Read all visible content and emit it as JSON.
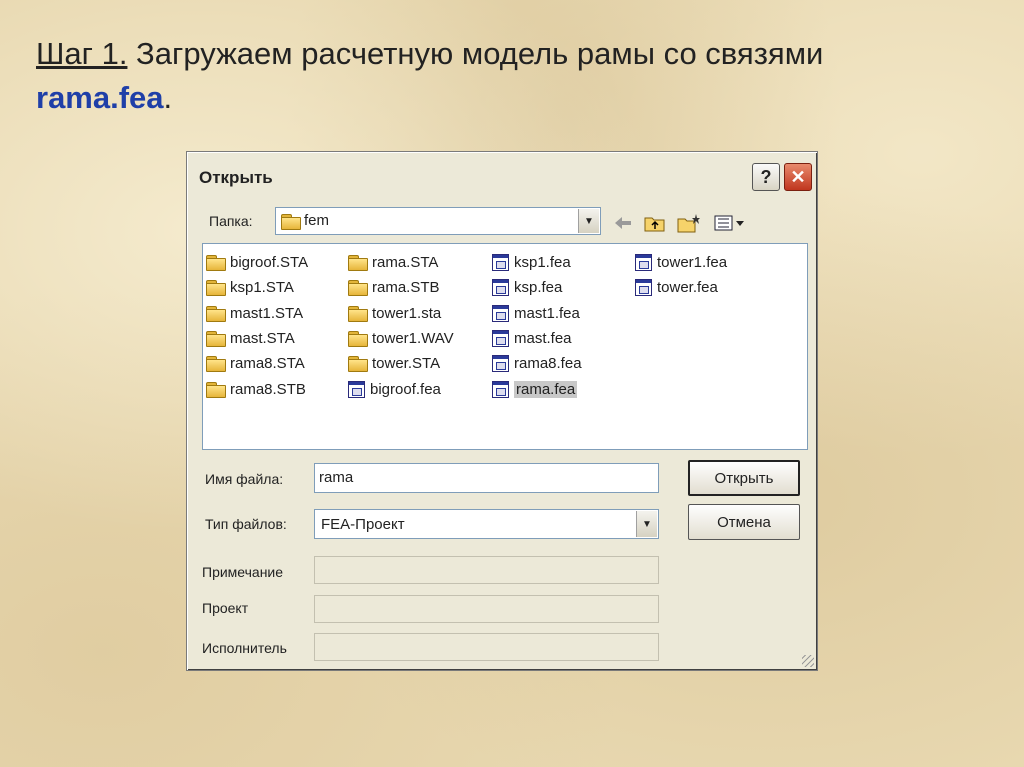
{
  "slide": {
    "step": "Шаг 1.",
    "text": " Загружаем расчетную модель рамы со связями",
    "filename": "rama.fea",
    "period": "."
  },
  "dialog": {
    "title": "Открыть",
    "help_symbol": "?",
    "close_symbol": "✕",
    "folder_label": "Папка:",
    "folder_value": "fem",
    "files": {
      "col1": [
        "bigroof.STA",
        "ksp1.STA",
        "mast1.STA",
        "mast.STA",
        "rama8.STA",
        "rama8.STB"
      ],
      "col2": [
        "rama.STA",
        "rama.STB",
        "tower1.sta",
        "tower1.WAV",
        "tower.STA",
        "bigroof.fea"
      ],
      "col3": [
        "ksp1.fea",
        "ksp.fea",
        "mast1.fea",
        "mast.fea",
        "rama8.fea",
        "rama.fea"
      ],
      "col4": [
        "tower1.fea",
        "tower.fea"
      ]
    },
    "selected_file": "rama.fea",
    "filename_label": "Имя файла:",
    "filename_value": "rama",
    "filetype_label": "Тип файлов:",
    "filetype_value": "FEA-Проект",
    "note_label": "Примечание",
    "project_label": "Проект",
    "author_label": "Исполнитель",
    "open_button": "Открыть",
    "cancel_button": "Отмена"
  },
  "colors": {
    "background": "#e8d8b0",
    "filename_accent": "#1f3fa8",
    "dialog_bg": "#ece9d8",
    "close_red": "#c0361e"
  },
  "icons": {
    "back": "arrow-left-icon",
    "up": "folder-up-icon",
    "new_folder": "new-folder-icon",
    "view_menu": "view-menu-icon"
  }
}
